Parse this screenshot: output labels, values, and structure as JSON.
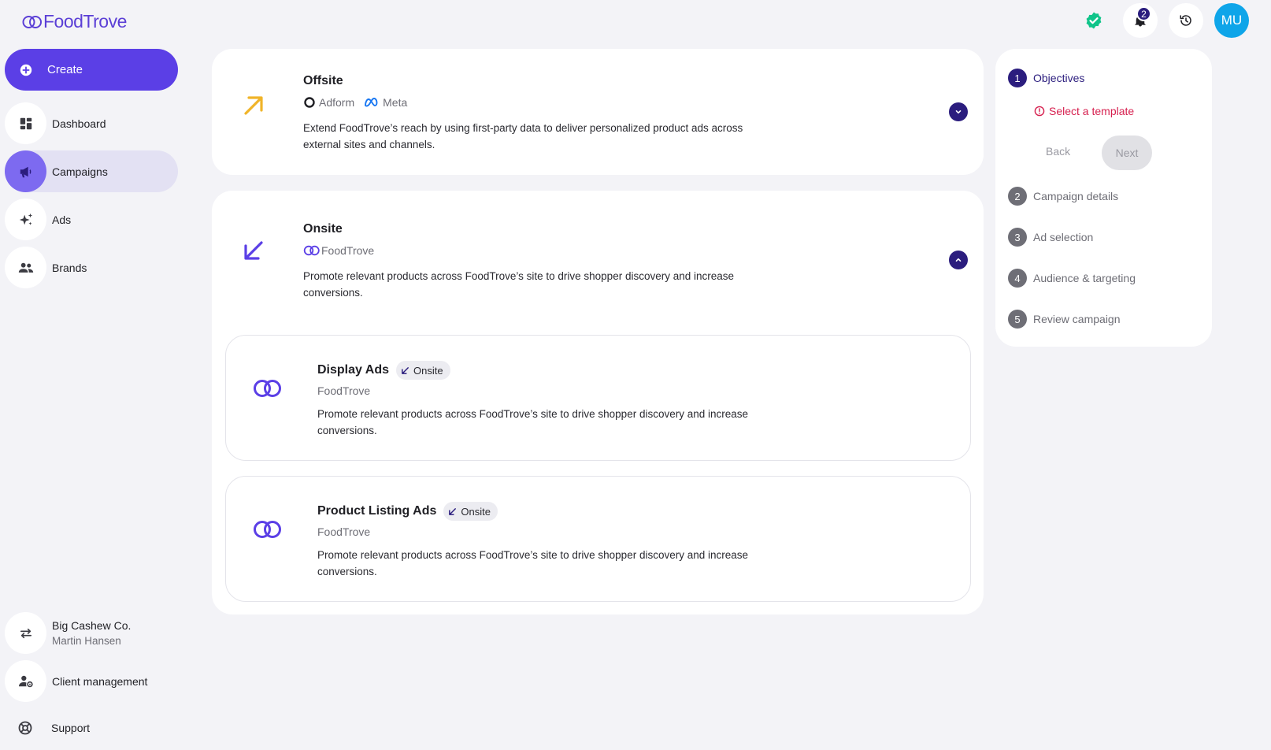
{
  "header": {
    "brand": "FoodTrove",
    "notification_count": "2",
    "avatar_initials": "MU"
  },
  "sidebar": {
    "create_label": "Create",
    "items": [
      {
        "label": "Dashboard",
        "icon": "dashboard-icon"
      },
      {
        "label": "Campaigns",
        "icon": "megaphone-icon",
        "active": true
      },
      {
        "label": "Ads",
        "icon": "sparkle-icon"
      },
      {
        "label": "Brands",
        "icon": "people-icon"
      }
    ],
    "account": {
      "company": "Big Cashew Co.",
      "user": "Martin Hansen"
    },
    "client_management": "Client management",
    "support": "Support"
  },
  "objectives": {
    "offsite": {
      "title": "Offsite",
      "channels": [
        "Adform",
        "Meta"
      ],
      "description": "Extend FoodTrove’s reach by using first-party data to deliver personalized product ads across external sites and channels."
    },
    "onsite": {
      "title": "Onsite",
      "channel": "FoodTrove",
      "description": "Promote relevant products across FoodTrove’s site to drive shopper discovery and increase conversions.",
      "templates": [
        {
          "title": "Display Ads",
          "tag": "Onsite",
          "brand": "FoodTrove",
          "description": "Promote relevant products across FoodTrove’s site to drive shopper discovery and increase conversions."
        },
        {
          "title": "Product Listing Ads",
          "tag": "Onsite",
          "brand": "FoodTrove",
          "description": "Promote relevant products across FoodTrove’s site to drive shopper discovery and increase conversions."
        }
      ]
    }
  },
  "stepper": {
    "steps": [
      {
        "num": "1",
        "label": "Objectives"
      },
      {
        "num": "2",
        "label": "Campaign details"
      },
      {
        "num": "3",
        "label": "Ad selection"
      },
      {
        "num": "4",
        "label": "Audience & targeting"
      },
      {
        "num": "5",
        "label": "Review campaign"
      }
    ],
    "warning": "Select a template",
    "back_label": "Back",
    "next_label": "Next"
  },
  "colors": {
    "primary": "#5b3fe6",
    "navy": "#2b1d7e",
    "offsite_arrow": "#f0b429",
    "onsite_arrow": "#5b3fe6",
    "error": "#d61f4e",
    "avatar": "#0ea5e9",
    "verified": "#10c48a"
  }
}
